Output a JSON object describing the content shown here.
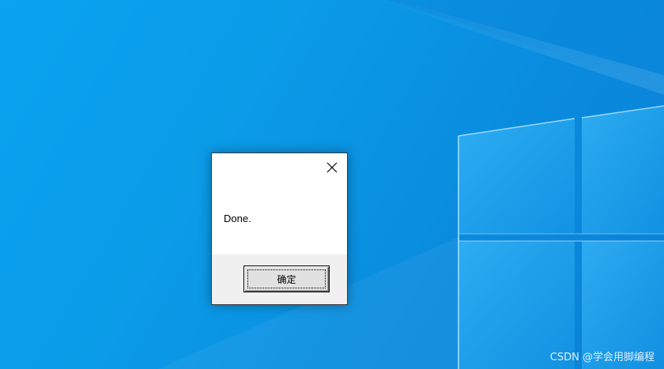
{
  "desktop": {
    "background_color": "#0b9be8",
    "logo": "windows-logo"
  },
  "dialog": {
    "message": "Done.",
    "ok_label": "确定",
    "close_icon": "close-icon"
  },
  "watermark": {
    "text": "CSDN @学会用脚编程"
  }
}
